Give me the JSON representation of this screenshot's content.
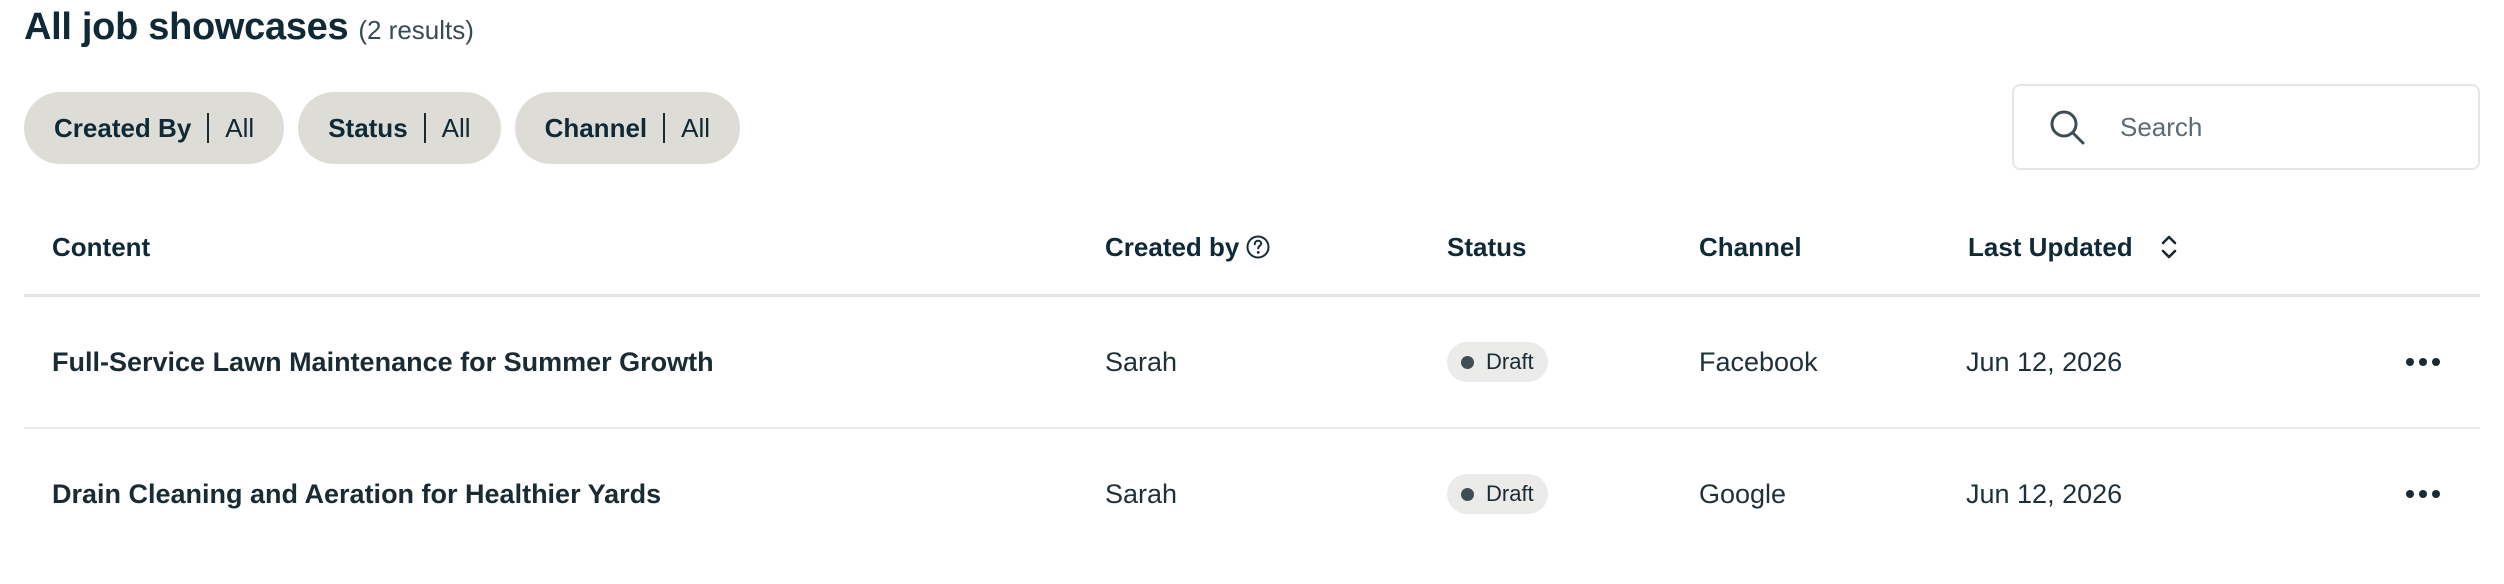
{
  "header": {
    "title": "All job showcases",
    "result_count": "(2 results)"
  },
  "filters": [
    {
      "label": "Created By",
      "value": "All"
    },
    {
      "label": "Status",
      "value": "All"
    },
    {
      "label": "Channel",
      "value": "All"
    }
  ],
  "search": {
    "placeholder": "Search",
    "value": "",
    "icon": "search-icon"
  },
  "table": {
    "columns": {
      "content": "Content",
      "created_by": "Created by",
      "status": "Status",
      "channel": "Channel",
      "last_updated": "Last Updated"
    },
    "rows": [
      {
        "content": "Full-Service Lawn Maintenance for Summer Growth",
        "created_by": "Sarah",
        "status": "Draft",
        "channel": "Facebook",
        "last_updated": "Jun 12, 2026"
      },
      {
        "content": "Drain Cleaning and Aeration for Healthier Yards",
        "created_by": "Sarah",
        "status": "Draft",
        "channel": "Google",
        "last_updated": "Jun 12, 2026"
      }
    ]
  },
  "colors": {
    "chip_background": "#dedcd7",
    "text_primary": "#0f2a36",
    "badge_background": "#ebebea"
  }
}
